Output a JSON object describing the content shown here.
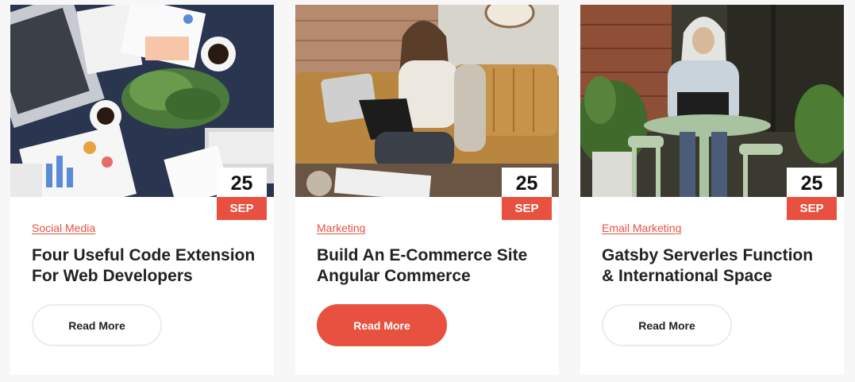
{
  "theme": {
    "accent": "#e8513f",
    "card_bg": "#ffffff",
    "page_bg": "#f7f7f7"
  },
  "cards": [
    {
      "image": "office-desk-laptops-charts-photo",
      "date": {
        "day": "25",
        "month": "SEP"
      },
      "category": "Social Media",
      "title_line1": "Four Useful Code Extension",
      "title_line2": "For Web Developers",
      "button_label": "Read More",
      "button_active": false
    },
    {
      "image": "woman-laptop-on-sofa-photo",
      "date": {
        "day": "25",
        "month": "SEP"
      },
      "category": "Marketing",
      "title_line1": "Build An E-Commerce Site",
      "title_line2": "Angular Commerce",
      "button_label": "Read More",
      "button_active": true
    },
    {
      "image": "woman-hijab-laptop-cafe-photo",
      "date": {
        "day": "25",
        "month": "SEP"
      },
      "category": "Email Marketing",
      "title_line1": "Gatsby Serverles Function",
      "title_line2": "& International Space",
      "button_label": "Read More",
      "button_active": false
    }
  ]
}
